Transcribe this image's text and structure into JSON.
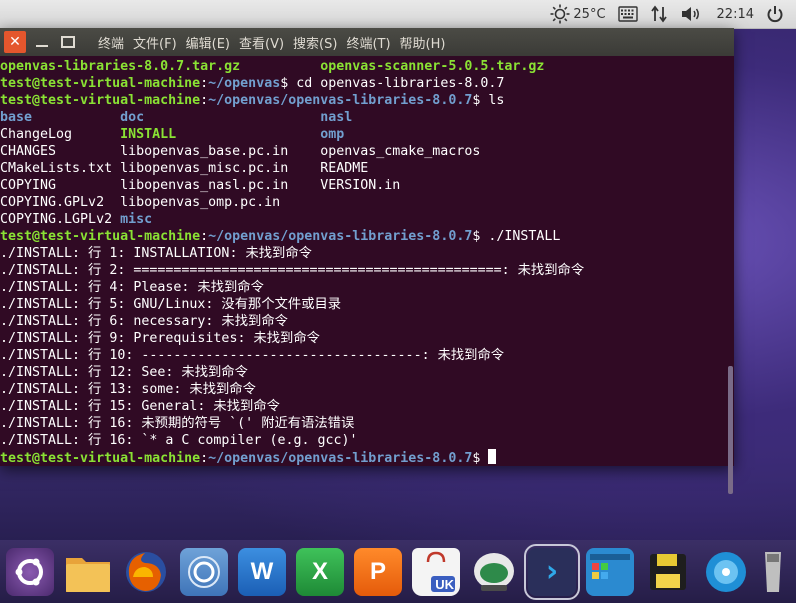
{
  "top_panel": {
    "temperature": "25°C",
    "clock": "22:14"
  },
  "window": {
    "menu": [
      "终端",
      "文件(F)",
      "编辑(E)",
      "查看(V)",
      "搜索(S)",
      "终端(T)",
      "帮助(H)"
    ]
  },
  "terminal": {
    "lines": [
      [
        {
          "t": "openvas-libraries-8.0.7.tar.gz",
          "c": "gb"
        },
        {
          "t": "          "
        },
        {
          "t": "openvas-scanner-5.0.5.tar.gz",
          "c": "gb"
        }
      ],
      [
        {
          "t": "test@test-virtual-machine",
          "c": "g"
        },
        {
          "t": ":"
        },
        {
          "t": "~/openvas",
          "c": "b"
        },
        {
          "t": "$ cd openvas-libraries-8.0.7"
        }
      ],
      [
        {
          "t": "test@test-virtual-machine",
          "c": "g"
        },
        {
          "t": ":"
        },
        {
          "t": "~/openvas/openvas-libraries-8.0.7",
          "c": "b"
        },
        {
          "t": "$ ls"
        }
      ],
      [
        {
          "t": "base",
          "c": "b"
        },
        {
          "t": "           "
        },
        {
          "t": "doc",
          "c": "b"
        },
        {
          "t": "                      "
        },
        {
          "t": "nasl",
          "c": "b"
        }
      ],
      [
        {
          "t": "ChangeLog      "
        },
        {
          "t": "INSTALL",
          "c": "gb"
        },
        {
          "t": "                  "
        },
        {
          "t": "omp",
          "c": "b"
        }
      ],
      [
        {
          "t": "CHANGES        libopenvas_base.pc.in    openvas_cmake_macros"
        }
      ],
      [
        {
          "t": "CMakeLists.txt libopenvas_misc.pc.in    README"
        }
      ],
      [
        {
          "t": "COPYING        libopenvas_nasl.pc.in    VERSION.in"
        }
      ],
      [
        {
          "t": "COPYING.GPLv2  libopenvas_omp.pc.in"
        }
      ],
      [
        {
          "t": "COPYING.LGPLv2 "
        },
        {
          "t": "misc",
          "c": "b"
        }
      ],
      [
        {
          "t": "test@test-virtual-machine",
          "c": "g"
        },
        {
          "t": ":"
        },
        {
          "t": "~/openvas/openvas-libraries-8.0.7",
          "c": "b"
        },
        {
          "t": "$ ./INSTALL"
        }
      ],
      [
        {
          "t": "./INSTALL: 行 1: INSTALLATION: 未找到命令"
        }
      ],
      [
        {
          "t": "./INSTALL: 行 2: ==============================================: 未找到命令"
        }
      ],
      [
        {
          "t": "./INSTALL: 行 4: Please: 未找到命令"
        }
      ],
      [
        {
          "t": "./INSTALL: 行 5: GNU/Linux: 没有那个文件或目录"
        }
      ],
      [
        {
          "t": "./INSTALL: 行 6: necessary: 未找到命令"
        }
      ],
      [
        {
          "t": "./INSTALL: 行 9: Prerequisites: 未找到命令"
        }
      ],
      [
        {
          "t": "./INSTALL: 行 10: -----------------------------------: 未找到命令"
        }
      ],
      [
        {
          "t": "./INSTALL: 行 12: See: 未找到命令"
        }
      ],
      [
        {
          "t": "./INSTALL: 行 13: some: 未找到命令"
        }
      ],
      [
        {
          "t": "./INSTALL: 行 15: General: 未找到命令"
        }
      ],
      [
        {
          "t": "./INSTALL: 行 16: 未预期的符号 `(' 附近有语法错误"
        }
      ],
      [
        {
          "t": "./INSTALL: 行 16: `* a C compiler (e.g. gcc)'"
        }
      ],
      [
        {
          "t": "test@test-virtual-machine",
          "c": "g"
        },
        {
          "t": ":"
        },
        {
          "t": "~/openvas/openvas-libraries-8.0.7",
          "c": "b"
        },
        {
          "t": "$ "
        }
      ]
    ]
  },
  "dock": {
    "items": [
      "ubuntu-logo",
      "files",
      "firefox",
      "chromium",
      "wps-writer",
      "wps-spreadsheets",
      "wps-presentation",
      "software-center",
      "ubuntu-tweak",
      "terminal",
      "workspace-switcher",
      "save",
      "dvd",
      "usb-drive"
    ],
    "office_letters": {
      "writer": "W",
      "sheet": "X",
      "present": "P",
      "uk": "UK"
    }
  }
}
